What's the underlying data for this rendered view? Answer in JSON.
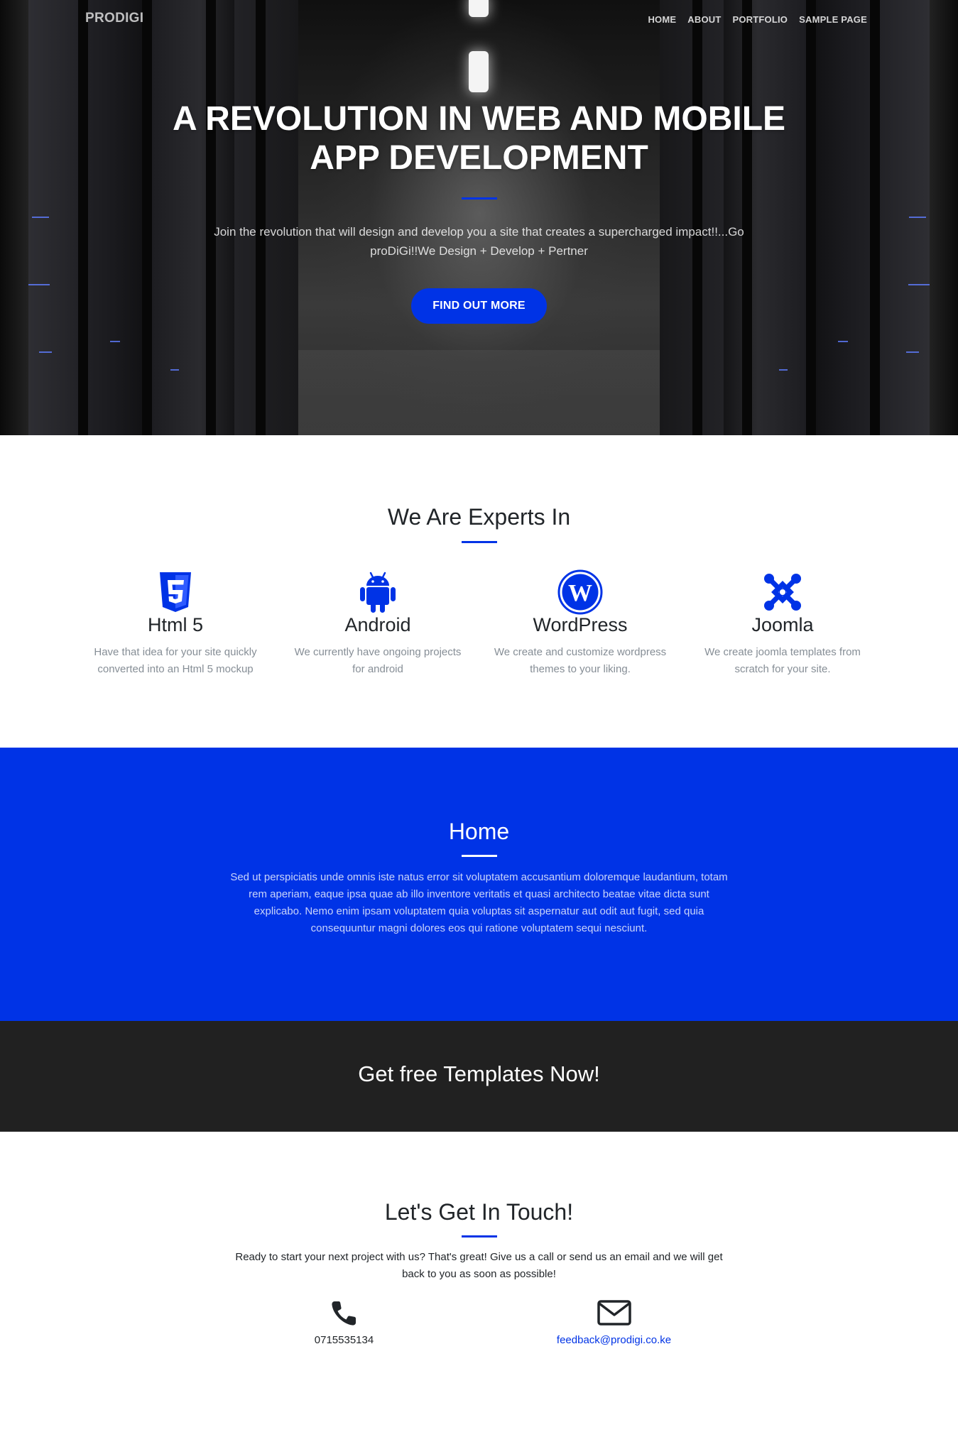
{
  "navbar": {
    "brand": "PRODIGI",
    "links": [
      "HOME",
      "ABOUT",
      "PORTFOLIO",
      "SAMPLE PAGE"
    ]
  },
  "hero": {
    "title": "A REVOLUTION IN WEB AND MOBILE APP DEVELOPMENT",
    "text": "Join the revolution that will design and develop you a site that creates a supercharged impact!!...Go proDiGi!!We Design + Develop + Pertner",
    "button_label": "FIND OUT MORE"
  },
  "experts": {
    "heading": "We Are Experts In",
    "services": [
      {
        "icon": "html5-icon",
        "title": "Html 5",
        "text": "Have that idea for your site quickly converted into an Html 5 mockup"
      },
      {
        "icon": "android-icon",
        "title": "Android",
        "text": "We currently have ongoing projects for android"
      },
      {
        "icon": "wordpress-icon",
        "title": "WordPress",
        "text": "We create and customize wordpress themes to your liking."
      },
      {
        "icon": "joomla-icon",
        "title": "Joomla",
        "text": "We create joomla templates from scratch for your site."
      }
    ]
  },
  "about": {
    "heading": "Home",
    "text": "Sed ut perspiciatis unde omnis iste natus error sit voluptatem accusantium doloremque laudantium, totam rem aperiam, eaque ipsa quae ab illo inventore veritatis et quasi architecto beatae vitae dicta sunt explicabo. Nemo enim ipsam voluptatem quia voluptas sit aspernatur aut odit aut fugit, sed quia consequuntur magni dolores eos qui ratione voluptatem sequi nesciunt."
  },
  "cta": {
    "title": "Get free Templates Now!"
  },
  "contact": {
    "heading": "Let's Get In Touch!",
    "text": "Ready to start your next project with us? That's great! Give us a call or send us an email and we will get back to you as soon as possible!",
    "phone": "0715535134",
    "email": "feedback@prodigi.co.ke",
    "phone_icon": "phone-icon",
    "email_icon": "envelope-icon"
  },
  "colors": {
    "primary": "#0033e6",
    "dark": "#212121",
    "muted_text": "#868e96"
  }
}
